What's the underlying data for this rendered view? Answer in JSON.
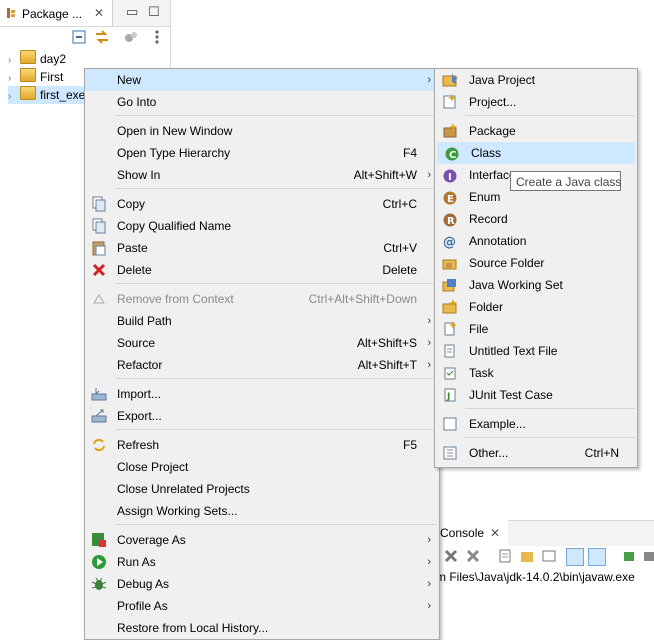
{
  "package_explorer": {
    "tab_title": "Package ...",
    "items": [
      {
        "label": "day2"
      },
      {
        "label": "First"
      },
      {
        "label": "first_exe"
      }
    ]
  },
  "console": {
    "tab_title": "Console",
    "path_text": "m Files\\Java\\jdk-14.0.2\\bin\\javaw.exe"
  },
  "context_menu": {
    "items": [
      {
        "label": "New",
        "accel": "",
        "submenu": true
      },
      {
        "label": "Go Into",
        "accel": ""
      },
      {
        "label": "Open in New Window",
        "accel": ""
      },
      {
        "label": "Open Type Hierarchy",
        "accel": "F4"
      },
      {
        "label": "Show In",
        "accel": "Alt+Shift+W",
        "submenu": true
      },
      {
        "label": "Copy",
        "accel": "Ctrl+C"
      },
      {
        "label": "Copy Qualified Name",
        "accel": ""
      },
      {
        "label": "Paste",
        "accel": "Ctrl+V"
      },
      {
        "label": "Delete",
        "accel": "Delete"
      },
      {
        "label": "Remove from Context",
        "accel": "Ctrl+Alt+Shift+Down"
      },
      {
        "label": "Build Path",
        "accel": "",
        "submenu": true
      },
      {
        "label": "Source",
        "accel": "Alt+Shift+S",
        "submenu": true
      },
      {
        "label": "Refactor",
        "accel": "Alt+Shift+T",
        "submenu": true
      },
      {
        "label": "Import...",
        "accel": ""
      },
      {
        "label": "Export...",
        "accel": ""
      },
      {
        "label": "Refresh",
        "accel": "F5"
      },
      {
        "label": "Close Project",
        "accel": ""
      },
      {
        "label": "Close Unrelated Projects",
        "accel": ""
      },
      {
        "label": "Assign Working Sets...",
        "accel": ""
      },
      {
        "label": "Coverage As",
        "accel": "",
        "submenu": true
      },
      {
        "label": "Run As",
        "accel": "",
        "submenu": true
      },
      {
        "label": "Debug As",
        "accel": "",
        "submenu": true
      },
      {
        "label": "Profile As",
        "accel": "",
        "submenu": true
      },
      {
        "label": "Restore from Local History...",
        "accel": ""
      }
    ]
  },
  "new_submenu": {
    "items": [
      {
        "label": "Java Project",
        "accel": ""
      },
      {
        "label": "Project...",
        "accel": ""
      },
      {
        "label": "Package",
        "accel": ""
      },
      {
        "label": "Class",
        "accel": ""
      },
      {
        "label": "Interface",
        "accel": ""
      },
      {
        "label": "Enum",
        "accel": ""
      },
      {
        "label": "Record",
        "accel": ""
      },
      {
        "label": "Annotation",
        "accel": ""
      },
      {
        "label": "Source Folder",
        "accel": ""
      },
      {
        "label": "Java Working Set",
        "accel": ""
      },
      {
        "label": "Folder",
        "accel": ""
      },
      {
        "label": "File",
        "accel": ""
      },
      {
        "label": "Untitled Text File",
        "accel": ""
      },
      {
        "label": "Task",
        "accel": ""
      },
      {
        "label": "JUnit Test Case",
        "accel": ""
      },
      {
        "label": "Example...",
        "accel": ""
      },
      {
        "label": "Other...",
        "accel": "Ctrl+N"
      }
    ]
  },
  "tooltip": {
    "text": "Create a Java class"
  },
  "colors": {
    "selection": "#cde8ff",
    "menu_bg": "#f0f0f0"
  }
}
